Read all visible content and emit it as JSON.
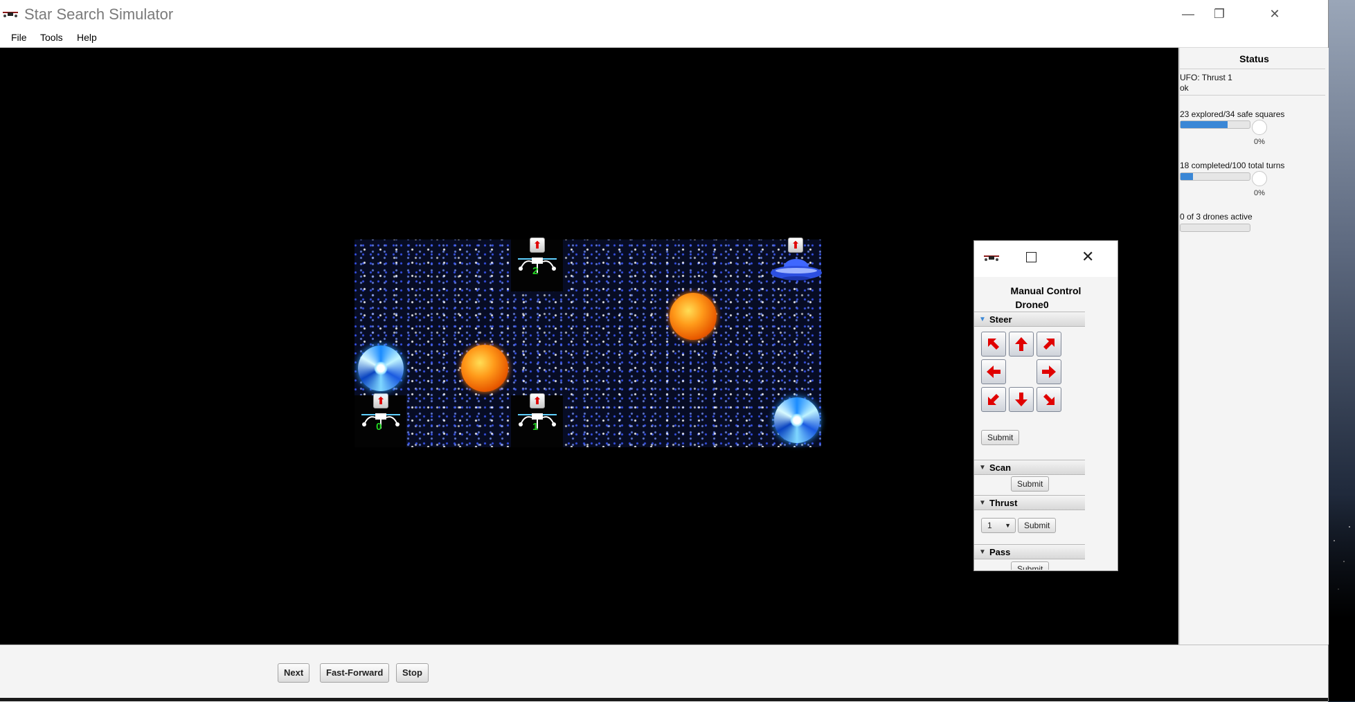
{
  "app": {
    "title": "Star Search Simulator",
    "window_controls": {
      "minimize": "—",
      "restore": "❐",
      "close": "✕"
    }
  },
  "menu": {
    "items": [
      {
        "label": "File"
      },
      {
        "label": "Tools"
      },
      {
        "label": "Help"
      }
    ]
  },
  "board": {
    "drones": [
      {
        "id": "2",
        "heading": "up"
      },
      {
        "id": "0",
        "heading": "up"
      },
      {
        "id": "1",
        "heading": "up"
      }
    ],
    "objects": [
      "sun",
      "sun",
      "wormhole",
      "wormhole",
      "ufo"
    ],
    "colors": {
      "drone_label": "#21d421",
      "heading_arrow": "#e00000",
      "ufo": "#2c4fe0"
    }
  },
  "manual_control": {
    "title_line1": "Manual Control",
    "title_line2": "Drone0",
    "sections": {
      "steer": {
        "label": "Steer",
        "submit": "Submit",
        "arrows": [
          "northwest-arrow",
          "north-arrow",
          "northeast-arrow",
          "west-arrow",
          "east-arrow",
          "southwest-arrow",
          "south-arrow",
          "southeast-arrow"
        ]
      },
      "scan": {
        "label": "Scan",
        "submit": "Submit"
      },
      "thrust": {
        "label": "Thrust",
        "value": "1",
        "submit": "Submit"
      },
      "pass": {
        "label": "Pass",
        "submit": "Submit"
      }
    }
  },
  "status": {
    "title": "Status",
    "ufo_line": "UFO: Thrust 1",
    "ufo_result": "ok",
    "explored_text": "23 explored/34 safe squares",
    "explored_progress": 0.676,
    "explored_pct": "0%",
    "turns_text": "18 completed/100 total turns",
    "turns_progress": 0.18,
    "turns_pct": "0%",
    "drones_text": "0 of 3 drones active",
    "drones_progress": 0
  },
  "bottom": {
    "next": "Next",
    "fast_forward": "Fast-Forward",
    "stop": "Stop"
  }
}
